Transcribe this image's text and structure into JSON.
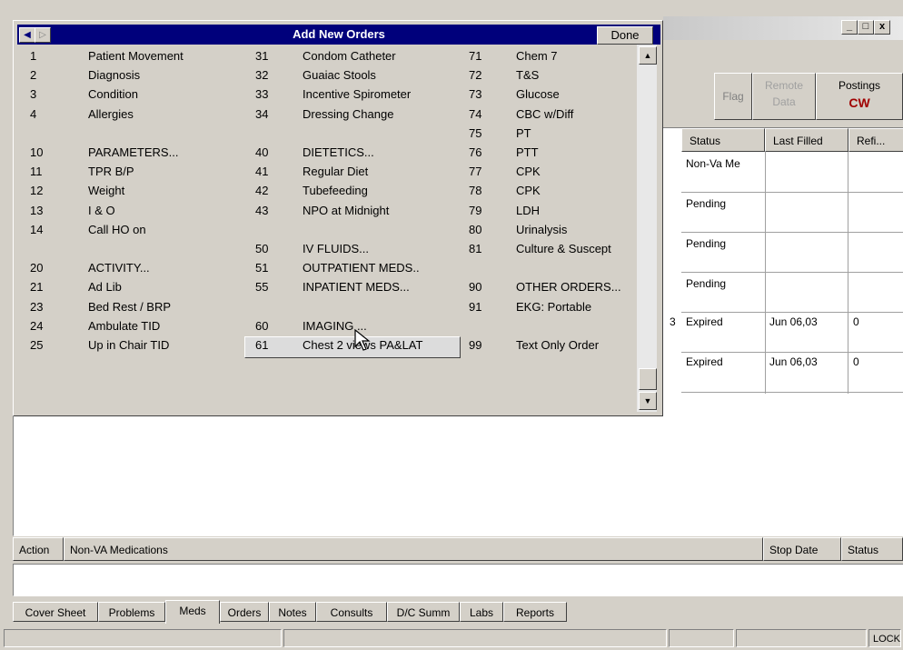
{
  "window": {
    "caption_min": "_",
    "caption_max": "□",
    "caption_close": "x"
  },
  "toolbar": {
    "flag": "Flag",
    "remote_1": "Remote",
    "remote_2": "Data",
    "postings": "Postings",
    "postings_code": "CW",
    "postings_code_color": "#a00000"
  },
  "med_grid": {
    "headers": [
      "Status",
      "Last Filled",
      "Refi..."
    ],
    "rows": [
      {
        "status": "Non-Va Me",
        "last_filled": "",
        "refills": ""
      },
      {
        "status": "Pending",
        "last_filled": "",
        "refills": ""
      },
      {
        "status": "Pending",
        "last_filled": "",
        "refills": ""
      },
      {
        "status": "Pending",
        "last_filled": "",
        "refills": ""
      },
      {
        "status": "Expired",
        "last_filled": "Jun 06,03",
        "refills": "0"
      },
      {
        "status": "Expired",
        "last_filled": "Jun 06,03",
        "refills": "0"
      }
    ],
    "partial_digit": "3"
  },
  "lower": {
    "headers": [
      "Action",
      "Non-VA Medications",
      "Stop Date",
      "Status"
    ]
  },
  "tabs": [
    "Cover Sheet",
    "Problems",
    "Meds",
    "Orders",
    "Notes",
    "Consults",
    "D/C Summ",
    "Labs",
    "Reports"
  ],
  "active_tab": "Meds",
  "status_bar": {
    "lock": "LOCK"
  },
  "popup": {
    "title": "Add New Orders",
    "done": "Done",
    "nav_prev": "◀",
    "nav_next": "▷",
    "scroll_up": "▲",
    "scroll_down": "▼",
    "selected_item": "55",
    "columns": [
      [
        {
          "num": "1",
          "label": "Patient Movement"
        },
        {
          "num": "2",
          "label": "Diagnosis"
        },
        {
          "num": "3",
          "label": "Condition"
        },
        {
          "num": "4",
          "label": "Allergies"
        },
        {
          "num": "",
          "label": ""
        },
        {
          "num": "10",
          "label": "PARAMETERS..."
        },
        {
          "num": "11",
          "label": "TPR B/P"
        },
        {
          "num": "12",
          "label": "Weight"
        },
        {
          "num": "13",
          "label": "I & O"
        },
        {
          "num": "14",
          "label": "Call HO on"
        },
        {
          "num": "",
          "label": ""
        },
        {
          "num": "20",
          "label": "ACTIVITY..."
        },
        {
          "num": "21",
          "label": "Ad Lib"
        },
        {
          "num": "23",
          "label": "Bed Rest / BRP"
        },
        {
          "num": "24",
          "label": "Ambulate TID"
        },
        {
          "num": "25",
          "label": "Up in Chair TID"
        }
      ],
      [
        {
          "num": "31",
          "label": "Condom Catheter"
        },
        {
          "num": "32",
          "label": "Guaiac Stools"
        },
        {
          "num": "33",
          "label": "Incentive Spirometer"
        },
        {
          "num": "34",
          "label": "Dressing Change"
        },
        {
          "num": "",
          "label": ""
        },
        {
          "num": "40",
          "label": "DIETETICS..."
        },
        {
          "num": "41",
          "label": "Regular Diet"
        },
        {
          "num": "42",
          "label": "Tubefeeding"
        },
        {
          "num": "43",
          "label": "NPO at Midnight"
        },
        {
          "num": "",
          "label": ""
        },
        {
          "num": "50",
          "label": "IV FLUIDS..."
        },
        {
          "num": "51",
          "label": "OUTPATIENT MEDS.."
        },
        {
          "num": "55",
          "label": "INPATIENT MEDS..."
        },
        {
          "num": "",
          "label": ""
        },
        {
          "num": "60",
          "label": "IMAGING ..."
        },
        {
          "num": "61",
          "label": "Chest 2 views PA&LAT"
        }
      ],
      [
        {
          "num": "71",
          "label": "Chem 7"
        },
        {
          "num": "72",
          "label": "T&S"
        },
        {
          "num": "73",
          "label": "Glucose"
        },
        {
          "num": "74",
          "label": "CBC w/Diff"
        },
        {
          "num": "75",
          "label": "PT"
        },
        {
          "num": "76",
          "label": "PTT"
        },
        {
          "num": "77",
          "label": "CPK"
        },
        {
          "num": "78",
          "label": "CPK"
        },
        {
          "num": "79",
          "label": "LDH"
        },
        {
          "num": "80",
          "label": "Urinalysis"
        },
        {
          "num": "81",
          "label": "Culture & Suscept"
        },
        {
          "num": "",
          "label": ""
        },
        {
          "num": "90",
          "label": "OTHER ORDERS..."
        },
        {
          "num": "91",
          "label": "EKG: Portable"
        },
        {
          "num": "",
          "label": ""
        },
        {
          "num": "99",
          "label": "Text Only Order"
        }
      ]
    ]
  }
}
